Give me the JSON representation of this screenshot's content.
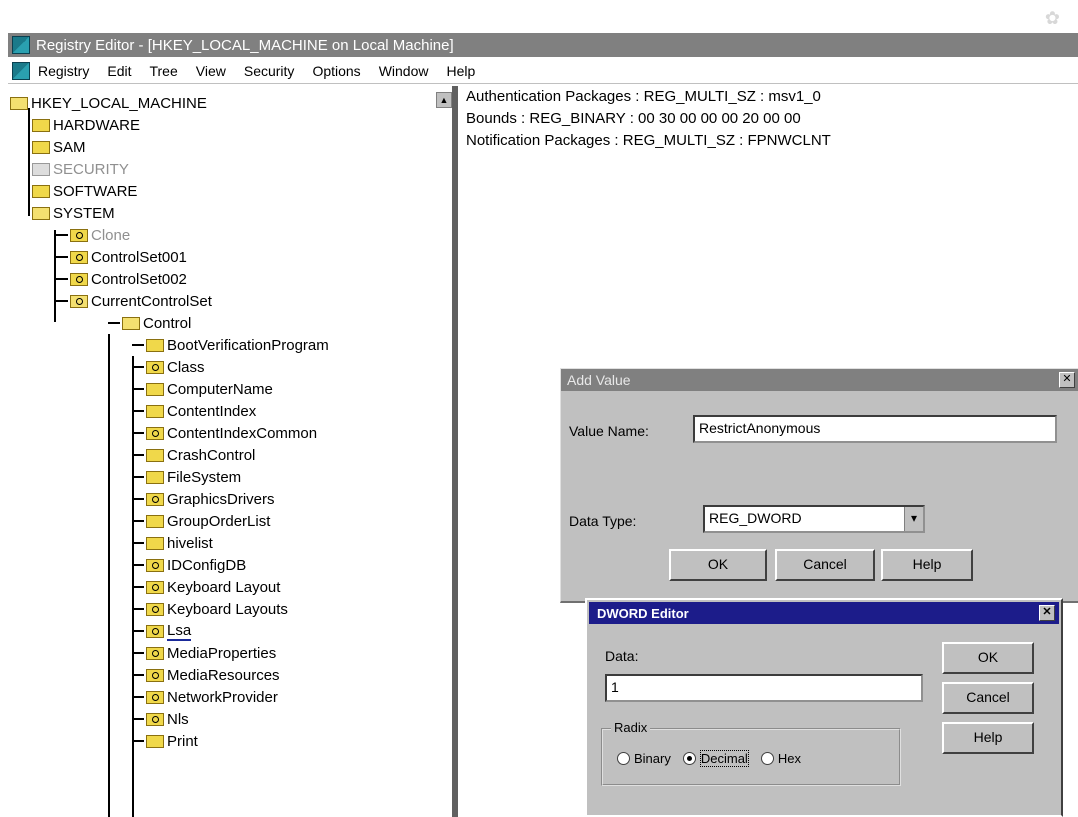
{
  "window": {
    "title": "Registry Editor - [HKEY_LOCAL_MACHINE on Local Machine]"
  },
  "menu": [
    "Registry",
    "Edit",
    "Tree",
    "View",
    "Security",
    "Options",
    "Window",
    "Help"
  ],
  "tree": {
    "root": "HKEY_LOCAL_MACHINE",
    "top_keys": [
      "HARDWARE",
      "SAM",
      "SECURITY",
      "SOFTWARE",
      "SYSTEM"
    ],
    "system_children": [
      "Clone",
      "ControlSet001",
      "ControlSet002",
      "CurrentControlSet"
    ],
    "ccs_child": "Control",
    "control_children": [
      "BootVerificationProgram",
      "Class",
      "ComputerName",
      "ContentIndex",
      "ContentIndexCommon",
      "CrashControl",
      "FileSystem",
      "GraphicsDrivers",
      "GroupOrderList",
      "hivelist",
      "IDConfigDB",
      "Keyboard Layout",
      "Keyboard Layouts",
      "Lsa",
      "MediaProperties",
      "MediaResources",
      "NetworkProvider",
      "Nls",
      "Print"
    ]
  },
  "values": [
    "Authentication Packages : REG_MULTI_SZ : msv1_0",
    "Bounds : REG_BINARY : 00 30 00 00 00 20 00 00",
    "Notification Packages : REG_MULTI_SZ : FPNWCLNT"
  ],
  "add_value": {
    "title": "Add Value",
    "value_name_label": "Value Name:",
    "value_name": "RestrictAnonymous",
    "data_type_label": "Data Type:",
    "data_type": "REG_DWORD",
    "ok": "OK",
    "cancel": "Cancel",
    "help": "Help"
  },
  "dword_editor": {
    "title": "DWORD Editor",
    "data_label": "Data:",
    "data_value": "1",
    "radix_label": "Radix",
    "radix_options": [
      "Binary",
      "Decimal",
      "Hex"
    ],
    "radix_selected": "Decimal",
    "ok": "OK",
    "cancel": "Cancel",
    "help": "Help"
  },
  "colors": {
    "titlebar_inactive": "#808080",
    "titlebar_active": "#1c1c8a",
    "dialog_face": "#c0c0c0"
  }
}
